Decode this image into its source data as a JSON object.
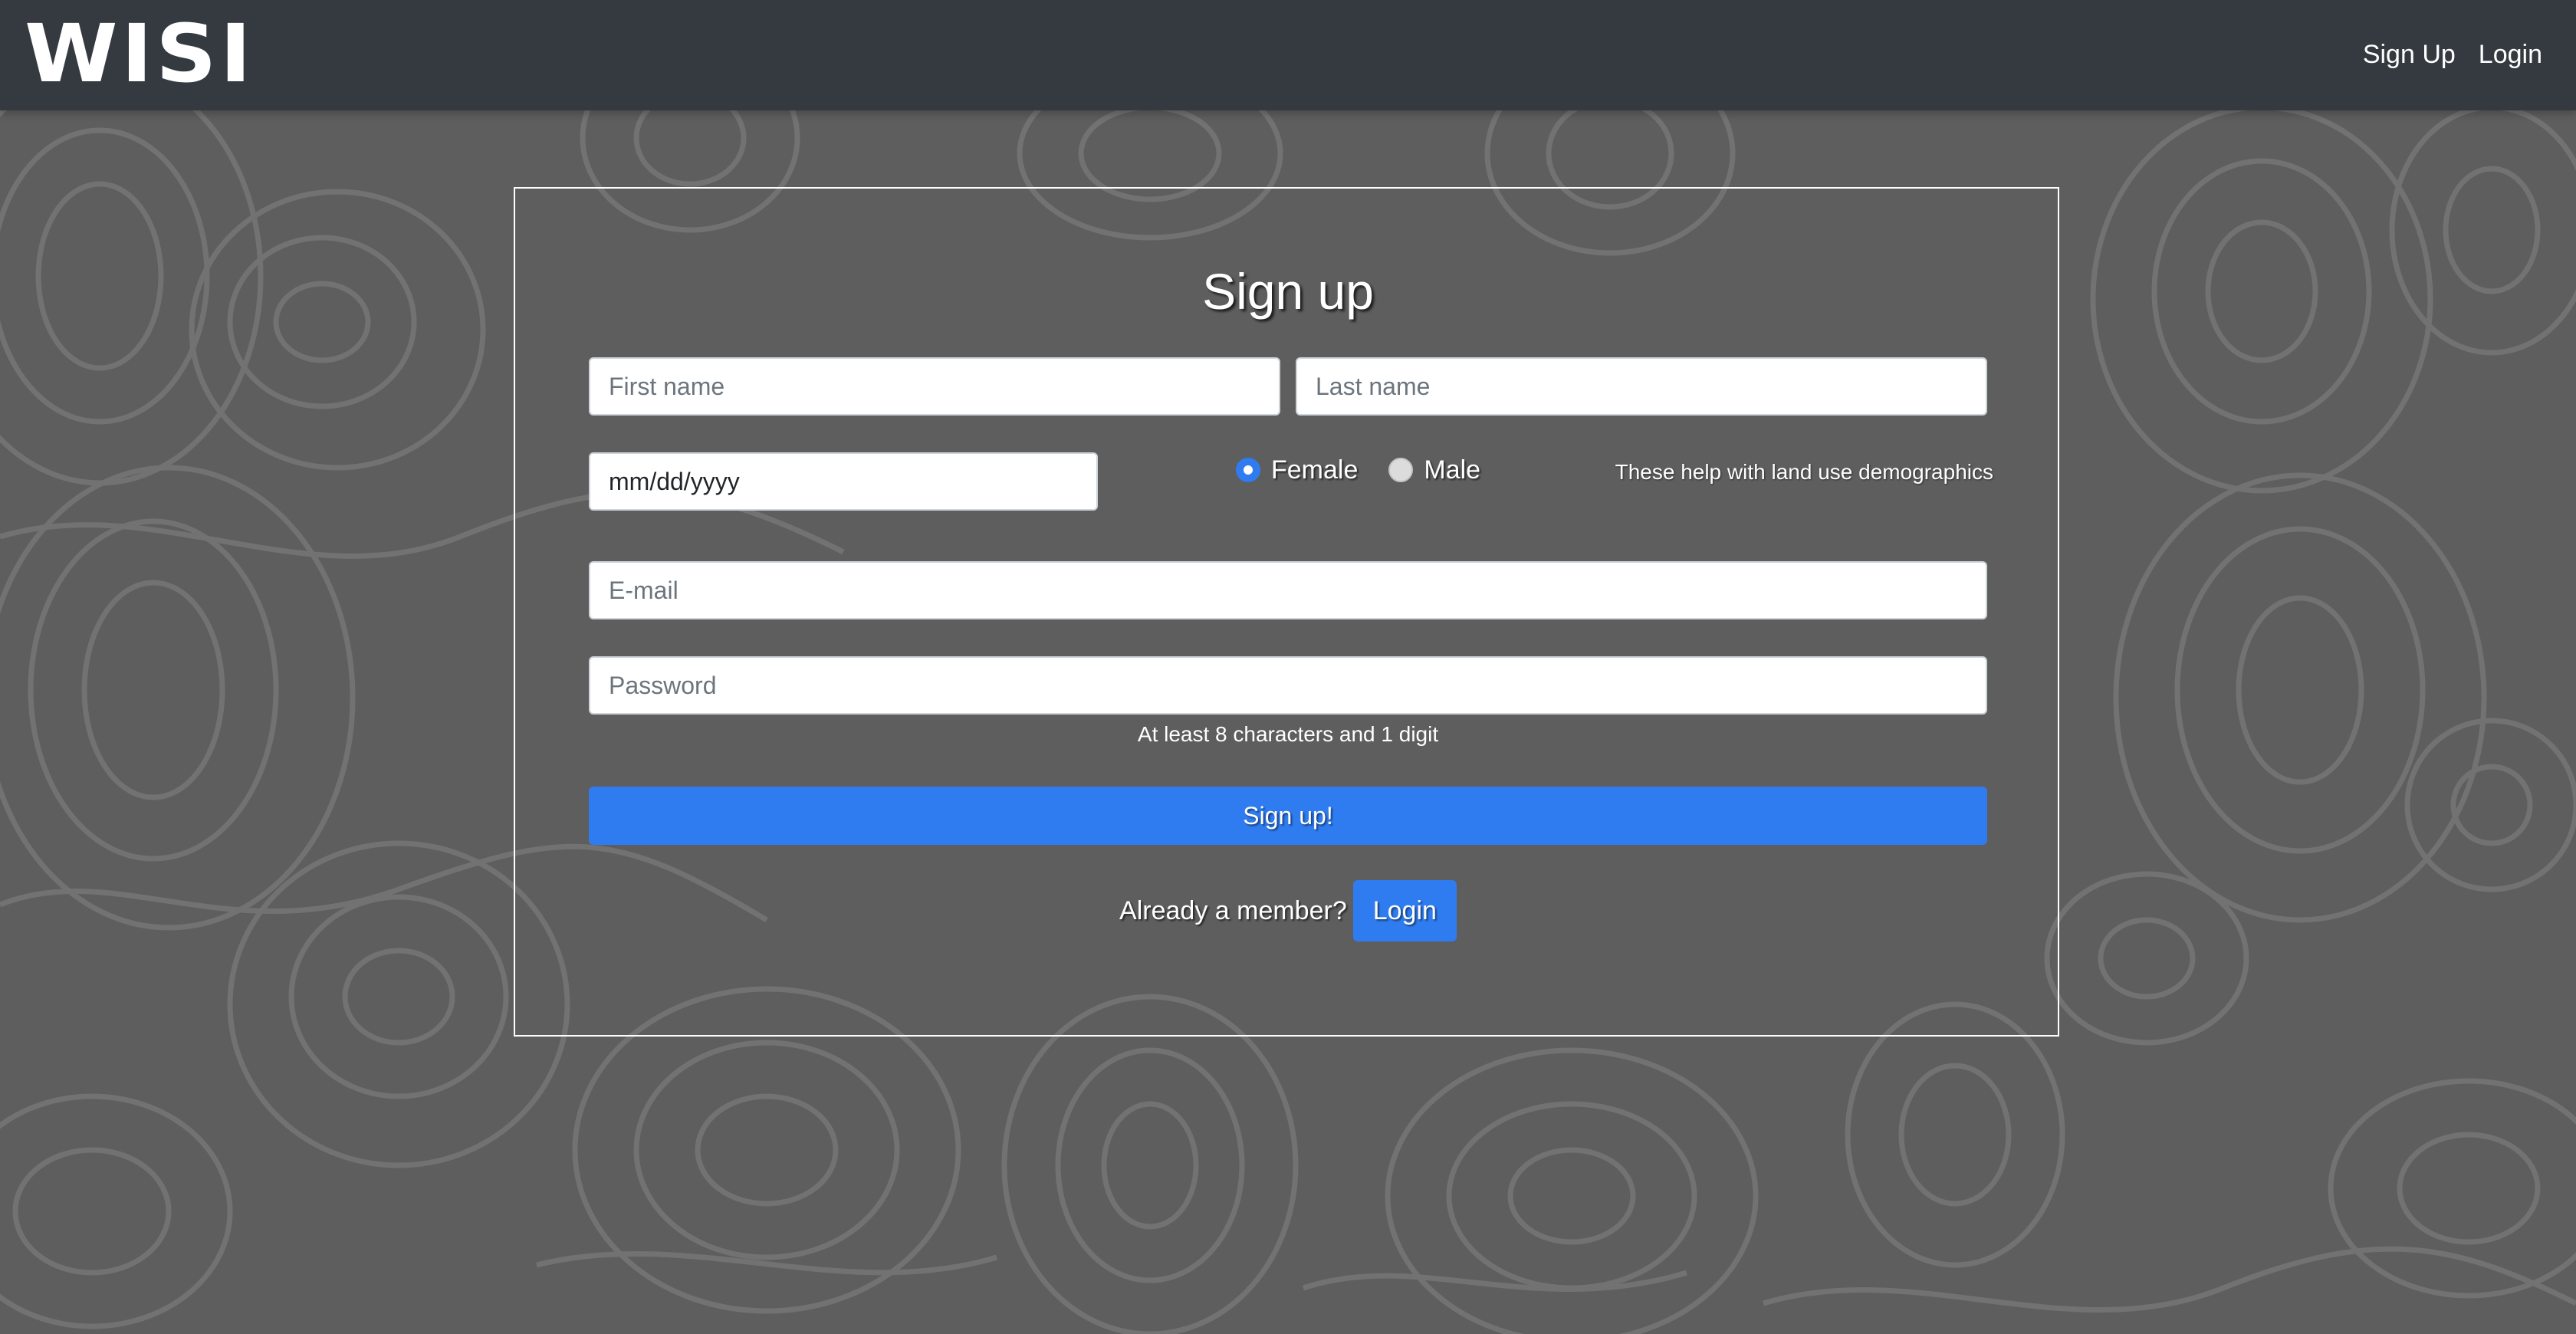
{
  "navbar": {
    "brand": "WISI",
    "links": [
      "Sign Up",
      "Login"
    ]
  },
  "form": {
    "title": "Sign up",
    "first_name_placeholder": "First name",
    "last_name_placeholder": "Last name",
    "date_placeholder": "mm/dd/yyyy",
    "gender_options": [
      "Female",
      "Male"
    ],
    "gender_selected": "Female",
    "demographics_note": "These help with land use demographics",
    "email_placeholder": "E-mail",
    "password_placeholder": "Password",
    "password_hint": "At least 8 characters and 1 digit",
    "submit_label": "Sign up!",
    "member_prompt": "Already a member?",
    "login_label": "Login"
  },
  "colors": {
    "navbar": "#343a40",
    "background": "#5e5e5e",
    "contour_lines": "#7a7a7a",
    "primary": "#2f7cf0"
  }
}
